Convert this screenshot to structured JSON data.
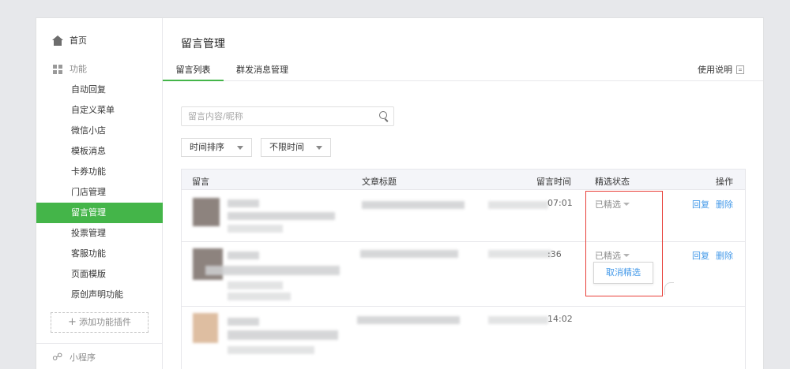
{
  "sidebar": {
    "home": "首页",
    "functions_header": "功能",
    "items": [
      "自动回复",
      "自定义菜单",
      "微信小店",
      "模板消息",
      "卡券功能",
      "门店管理",
      "留言管理",
      "投票管理",
      "客服功能",
      "页面模版",
      "原创声明功能"
    ],
    "active_item": "留言管理",
    "add_plugin": "添加功能插件",
    "mini_program": "小程序"
  },
  "header": {
    "title": "留言管理",
    "tabs": [
      "留言列表",
      "群发消息管理"
    ],
    "help": "使用说明"
  },
  "toolbar": {
    "search_placeholder": "留言内容/昵称",
    "sort_select": "时间排序",
    "time_select": "不限时间"
  },
  "table": {
    "columns": [
      "留言",
      "文章标题",
      "留言时间",
      "精选状态",
      "操作"
    ],
    "rows": [
      {
        "time_tail": "07:01",
        "status": "已精选",
        "actions": [
          "回复",
          "删除"
        ]
      },
      {
        "time_tail": ":36",
        "status": "已精选",
        "actions": [
          "回复",
          "删除"
        ],
        "popover": "取消精选"
      },
      {
        "time_tail": "14:02"
      }
    ]
  },
  "colors": {
    "accent_green": "#44b549",
    "link_blue": "#459ae9",
    "highlight_red": "#e8403a"
  }
}
